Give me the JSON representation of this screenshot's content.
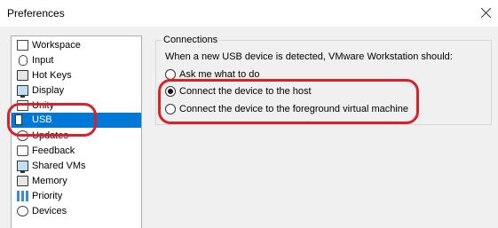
{
  "window": {
    "title": "Preferences"
  },
  "sidebar": {
    "items": [
      {
        "label": "Workspace",
        "icon": "workspace-icon"
      },
      {
        "label": "Input",
        "icon": "mouse-icon"
      },
      {
        "label": "Hot Keys",
        "icon": "keyboard-icon"
      },
      {
        "label": "Display",
        "icon": "monitor-icon"
      },
      {
        "label": "Unity",
        "icon": "unity-icon"
      },
      {
        "label": "USB",
        "icon": "usb-icon",
        "selected": true
      },
      {
        "label": "Updates",
        "icon": "updates-icon"
      },
      {
        "label": "Feedback",
        "icon": "feedback-icon"
      },
      {
        "label": "Shared VMs",
        "icon": "shared-vms-icon"
      },
      {
        "label": "Memory",
        "icon": "memory-icon"
      },
      {
        "label": "Priority",
        "icon": "priority-icon"
      },
      {
        "label": "Devices",
        "icon": "devices-icon"
      }
    ]
  },
  "connections": {
    "group_label": "Connections",
    "intro": "When a new USB device is detected, VMware Workstation should:",
    "options": [
      {
        "label": "Ask me what to do",
        "selected": false
      },
      {
        "label": "Connect the device to the host",
        "selected": true
      },
      {
        "label": "Connect the device to the foreground virtual machine",
        "selected": false
      }
    ]
  },
  "colors": {
    "selection": "#0078d7",
    "annotation": "#d9212a"
  }
}
